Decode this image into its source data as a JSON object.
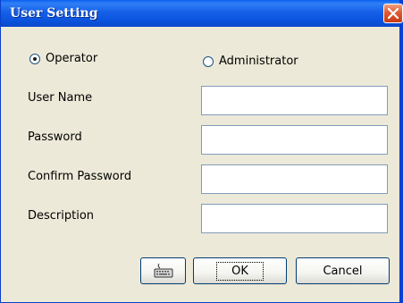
{
  "window": {
    "title": "User Setting"
  },
  "role": {
    "operator_label": "Operator",
    "administrator_label": "Administrator",
    "selected": "Operator"
  },
  "fields": [
    {
      "label": "User Name",
      "value": ""
    },
    {
      "label": "Password",
      "value": ""
    },
    {
      "label": "Confirm Password",
      "value": ""
    },
    {
      "label": "Description",
      "value": ""
    }
  ],
  "buttons": {
    "keyboard_icon": "keyboard-icon",
    "ok_label": "OK",
    "cancel_label": "Cancel"
  },
  "colors": {
    "titlebar": "#0a52db",
    "dialog_bg": "#ece9d8",
    "close_button": "#e05a34"
  }
}
